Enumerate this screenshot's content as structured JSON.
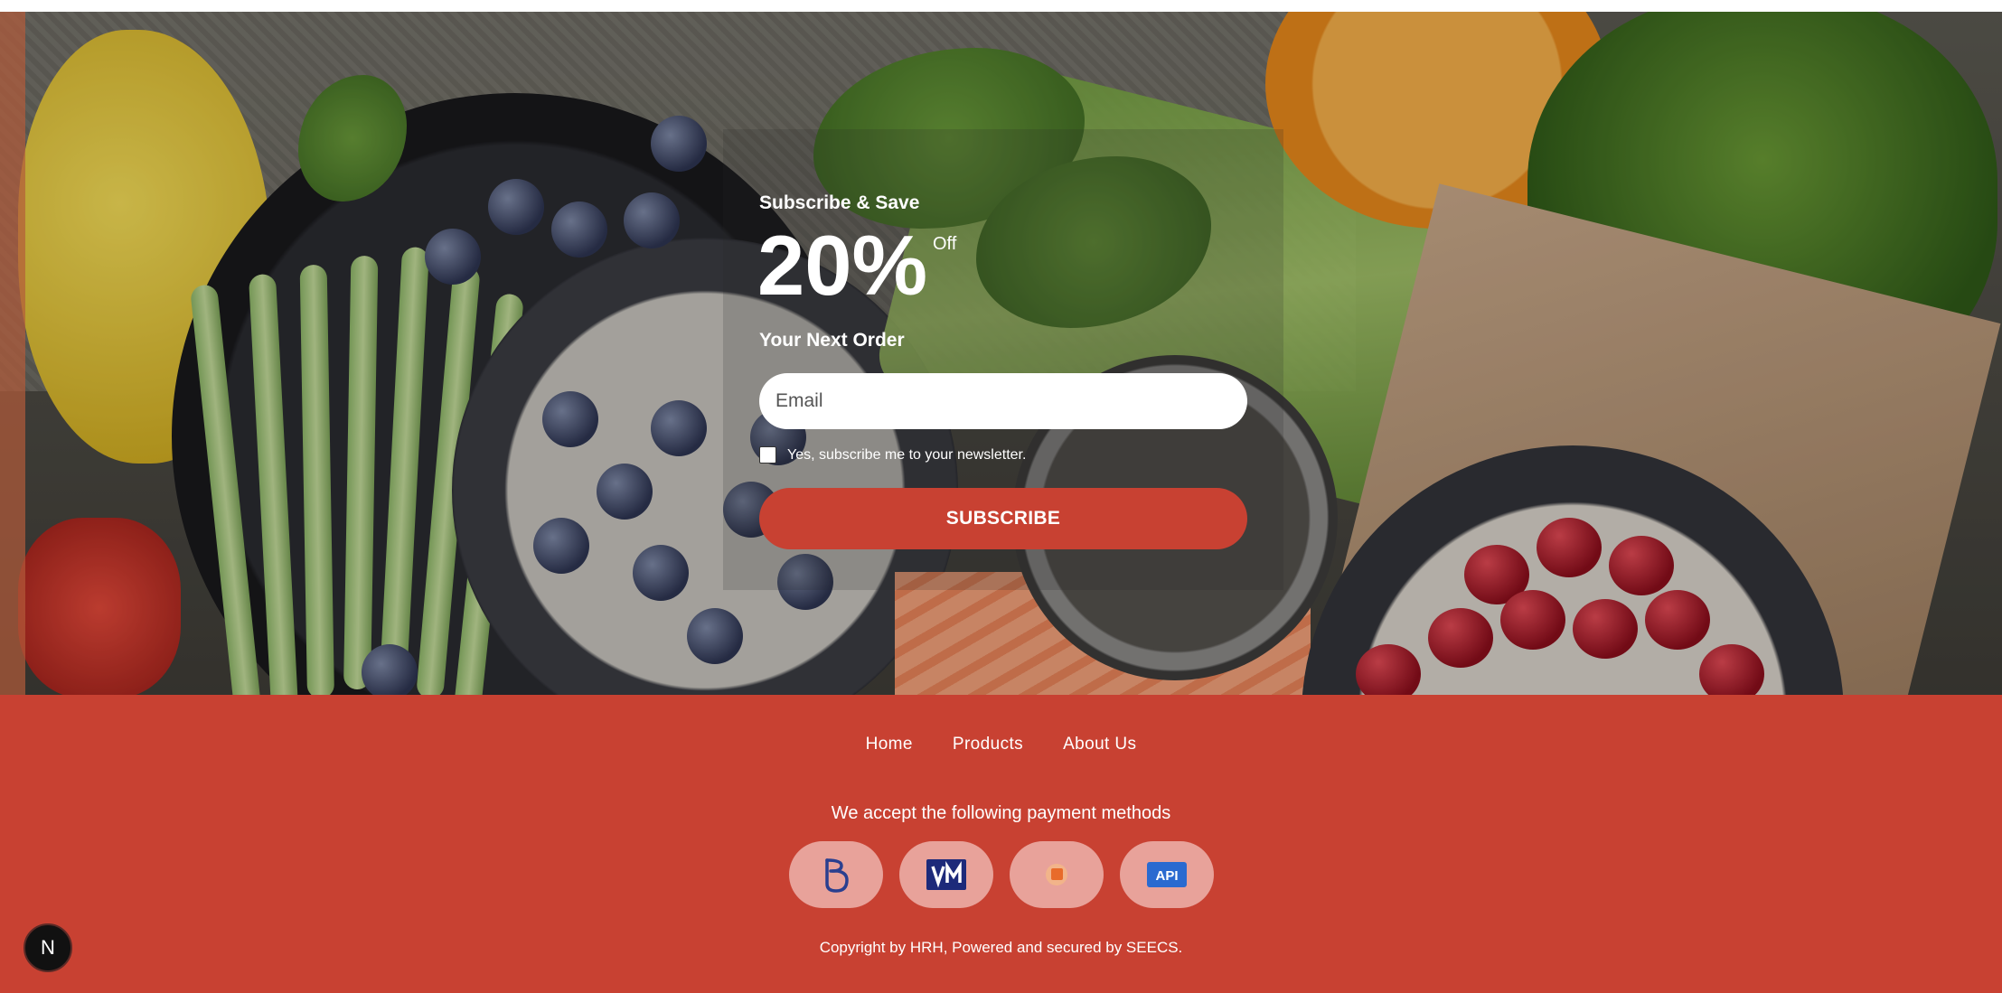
{
  "hero": {
    "kicker": "Subscribe & Save",
    "discount": "20%",
    "discount_suffix": "Off",
    "subheading": "Your Next Order",
    "email_placeholder": "Email",
    "newsletter_label": "Yes, subscribe me to your newsletter.",
    "subscribe_label": "SUBSCRIBE"
  },
  "footer": {
    "nav": [
      {
        "label": "Home"
      },
      {
        "label": "Products"
      },
      {
        "label": "About Us"
      }
    ],
    "payment_text": "We accept the following payment methods",
    "payment_methods": [
      {
        "icon": "p-logo-icon"
      },
      {
        "icon": "vm-card-icon"
      },
      {
        "icon": "orange-square-icon"
      },
      {
        "icon": "api-logo-icon"
      }
    ],
    "copyright": "Copyright by HRH, Powered and secured by SEECS."
  },
  "badge": {
    "label": "N"
  },
  "colors": {
    "accent": "#c84132",
    "pay_bubble": "#e8a29a",
    "text_on_accent": "#ffffff"
  }
}
